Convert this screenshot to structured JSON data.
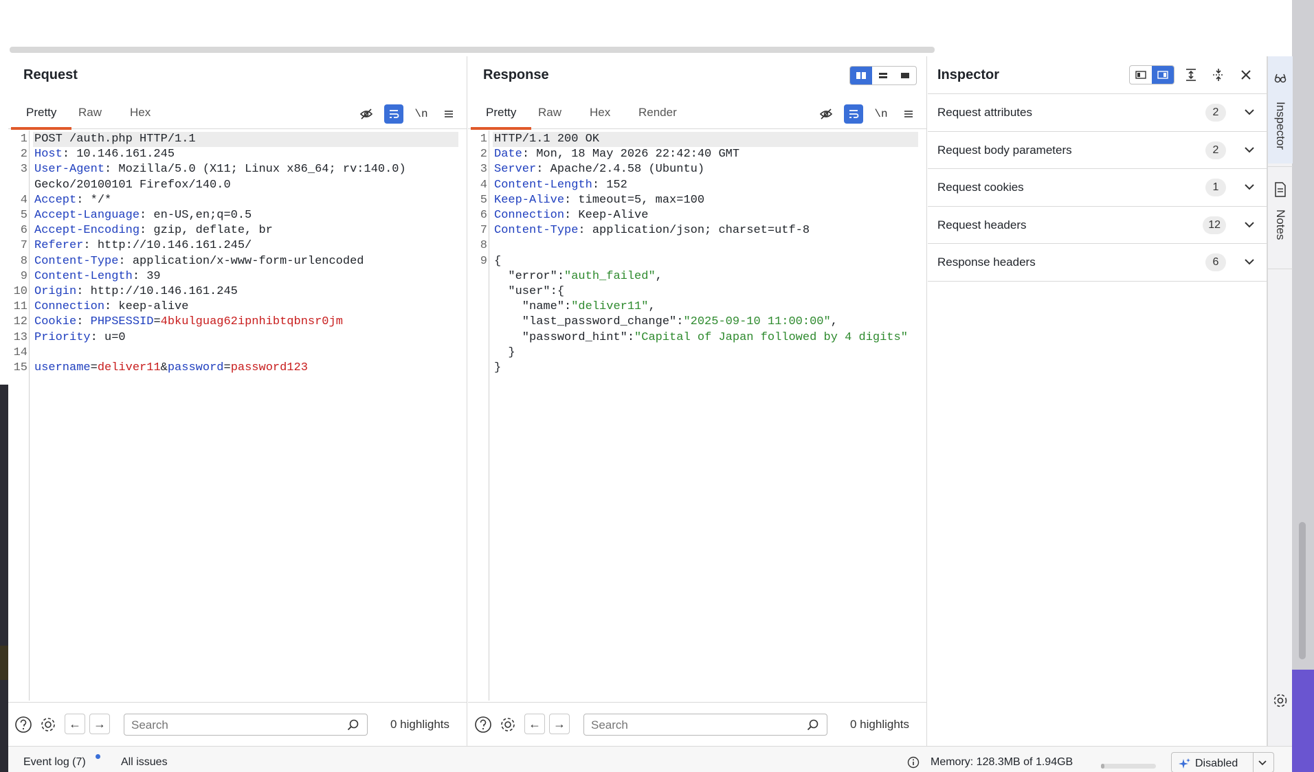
{
  "request": {
    "title": "Request",
    "tabs": [
      "Pretty",
      "Raw",
      "Hex"
    ],
    "newline_label": "\\n",
    "lines": [
      {
        "n": "1",
        "parts": [
          {
            "t": "POST /auth.php HTTP/1.1",
            "c": ""
          }
        ]
      },
      {
        "n": "2",
        "parts": [
          {
            "t": "Host",
            "c": "k"
          },
          {
            "t": ": 10.146.161.245",
            "c": ""
          }
        ]
      },
      {
        "n": "3",
        "parts": [
          {
            "t": "User-Agent",
            "c": "k"
          },
          {
            "t": ": Mozilla/5.0 (X11; Linux x86_64; rv:140.0)",
            "c": ""
          }
        ]
      },
      {
        "n": "",
        "parts": [
          {
            "t": "Gecko/20100101 Firefox/140.0",
            "c": ""
          }
        ]
      },
      {
        "n": "4",
        "parts": [
          {
            "t": "Accept",
            "c": "k"
          },
          {
            "t": ": */*",
            "c": ""
          }
        ]
      },
      {
        "n": "5",
        "parts": [
          {
            "t": "Accept-Language",
            "c": "k"
          },
          {
            "t": ": en-US,en;q=0.5",
            "c": ""
          }
        ]
      },
      {
        "n": "6",
        "parts": [
          {
            "t": "Accept-Encoding",
            "c": "k"
          },
          {
            "t": ": gzip, deflate, br",
            "c": ""
          }
        ]
      },
      {
        "n": "7",
        "parts": [
          {
            "t": "Referer",
            "c": "k"
          },
          {
            "t": ": http://10.146.161.245/",
            "c": ""
          }
        ]
      },
      {
        "n": "8",
        "parts": [
          {
            "t": "Content-Type",
            "c": "k"
          },
          {
            "t": ": application/x-www-form-urlencoded",
            "c": ""
          }
        ]
      },
      {
        "n": "9",
        "parts": [
          {
            "t": "Content-Length",
            "c": "k"
          },
          {
            "t": ": 39",
            "c": ""
          }
        ]
      },
      {
        "n": "10",
        "parts": [
          {
            "t": "Origin",
            "c": "k"
          },
          {
            "t": ": http://10.146.161.245",
            "c": ""
          }
        ]
      },
      {
        "n": "11",
        "parts": [
          {
            "t": "Connection",
            "c": "k"
          },
          {
            "t": ": keep-alive",
            "c": ""
          }
        ]
      },
      {
        "n": "12",
        "parts": [
          {
            "t": "Cookie",
            "c": "k"
          },
          {
            "t": ": ",
            "c": ""
          },
          {
            "t": "PHPSESSID",
            "c": "k"
          },
          {
            "t": "=",
            "c": ""
          },
          {
            "t": "4bkulguag62ipnhibtqbnsr0jm",
            "c": "v"
          }
        ]
      },
      {
        "n": "13",
        "parts": [
          {
            "t": "Priority",
            "c": "k"
          },
          {
            "t": ": u=0",
            "c": ""
          }
        ]
      },
      {
        "n": "14",
        "parts": []
      },
      {
        "n": "15",
        "parts": [
          {
            "t": "username",
            "c": "k"
          },
          {
            "t": "=",
            "c": ""
          },
          {
            "t": "deliver11",
            "c": "v"
          },
          {
            "t": "&",
            "c": ""
          },
          {
            "t": "password",
            "c": "k"
          },
          {
            "t": "=",
            "c": ""
          },
          {
            "t": "password123",
            "c": "v"
          }
        ]
      }
    ],
    "search_placeholder": "Search",
    "highlights": "0 highlights"
  },
  "response": {
    "title": "Response",
    "tabs": [
      "Pretty",
      "Raw",
      "Hex",
      "Render"
    ],
    "newline_label": "\\n",
    "lines": [
      {
        "n": "1",
        "parts": [
          {
            "t": "HTTP/1.1 200 OK",
            "c": ""
          }
        ]
      },
      {
        "n": "2",
        "parts": [
          {
            "t": "Date",
            "c": "k"
          },
          {
            "t": ": Mon, 18 May 2026 22:42:40 GMT",
            "c": ""
          }
        ]
      },
      {
        "n": "3",
        "parts": [
          {
            "t": "Server",
            "c": "k"
          },
          {
            "t": ": Apache/2.4.58 (Ubuntu)",
            "c": ""
          }
        ]
      },
      {
        "n": "4",
        "parts": [
          {
            "t": "Content-Length",
            "c": "k"
          },
          {
            "t": ": 152",
            "c": ""
          }
        ]
      },
      {
        "n": "5",
        "parts": [
          {
            "t": "Keep-Alive",
            "c": "k"
          },
          {
            "t": ": timeout=5, max=100",
            "c": ""
          }
        ]
      },
      {
        "n": "6",
        "parts": [
          {
            "t": "Connection",
            "c": "k"
          },
          {
            "t": ": Keep-Alive",
            "c": ""
          }
        ]
      },
      {
        "n": "7",
        "parts": [
          {
            "t": "Content-Type",
            "c": "k"
          },
          {
            "t": ": application/json; charset=utf-8",
            "c": ""
          }
        ]
      },
      {
        "n": "8",
        "parts": []
      },
      {
        "n": "9",
        "parts": [
          {
            "t": "{",
            "c": ""
          }
        ]
      },
      {
        "n": "",
        "parts": [
          {
            "t": "  \"error\"",
            "c": ""
          },
          {
            "t": ":",
            "c": ""
          },
          {
            "t": "\"auth_failed\"",
            "c": "s"
          },
          {
            "t": ",",
            "c": ""
          }
        ]
      },
      {
        "n": "",
        "parts": [
          {
            "t": "  \"user\"",
            "c": ""
          },
          {
            "t": ":{",
            "c": ""
          }
        ]
      },
      {
        "n": "",
        "parts": [
          {
            "t": "    \"name\"",
            "c": ""
          },
          {
            "t": ":",
            "c": ""
          },
          {
            "t": "\"deliver11\"",
            "c": "s"
          },
          {
            "t": ",",
            "c": ""
          }
        ]
      },
      {
        "n": "",
        "parts": [
          {
            "t": "    \"last_password_change\"",
            "c": ""
          },
          {
            "t": ":",
            "c": ""
          },
          {
            "t": "\"2025-09-10 11:00:00\"",
            "c": "s"
          },
          {
            "t": ",",
            "c": ""
          }
        ]
      },
      {
        "n": "",
        "parts": [
          {
            "t": "    \"password_hint\"",
            "c": ""
          },
          {
            "t": ":",
            "c": ""
          },
          {
            "t": "\"Capital of Japan followed by 4 digits\"",
            "c": "s"
          }
        ]
      },
      {
        "n": "",
        "parts": [
          {
            "t": "  }",
            "c": ""
          }
        ]
      },
      {
        "n": "",
        "parts": [
          {
            "t": "}",
            "c": ""
          }
        ]
      }
    ],
    "search_placeholder": "Search",
    "highlights": "0 highlights"
  },
  "inspector": {
    "title": "Inspector",
    "sections": [
      {
        "label": "Request attributes",
        "count": "2"
      },
      {
        "label": "Request body parameters",
        "count": "2"
      },
      {
        "label": "Request cookies",
        "count": "1"
      },
      {
        "label": "Request headers",
        "count": "12"
      },
      {
        "label": "Response headers",
        "count": "6"
      }
    ]
  },
  "side_rail": {
    "inspector_label": "Inspector",
    "notes_label": "Notes"
  },
  "status_bar": {
    "event_log": "Event log (7)",
    "all_issues": "All issues",
    "memory": "Memory: 128.3MB of 1.94GB",
    "memory_fraction": 0.06,
    "ai_state": "Disabled"
  },
  "colors": {
    "accent_blue": "#3a6fd8",
    "tab_underline": "#e05a2b",
    "header_key": "#1f3fbf",
    "value_red": "#c81d1d",
    "json_string": "#2e8a2e"
  }
}
